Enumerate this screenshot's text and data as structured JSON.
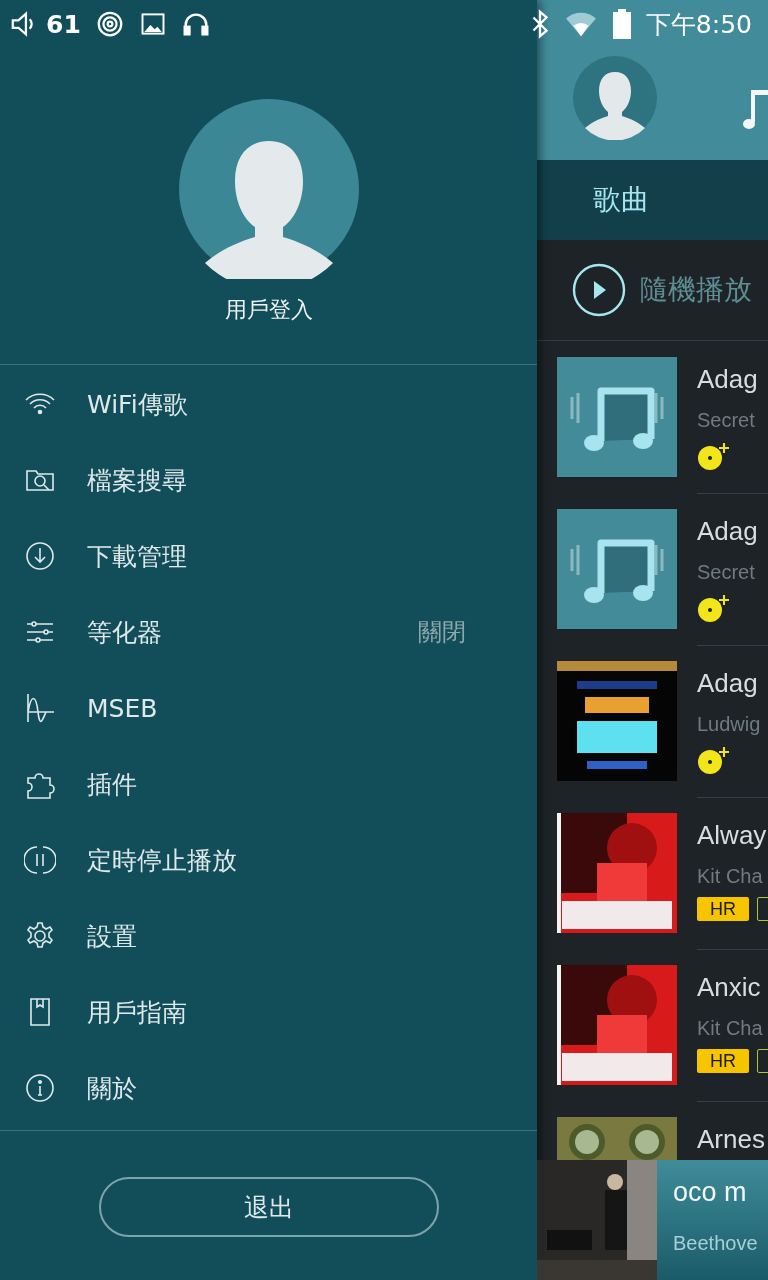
{
  "status_bar": {
    "volume": "61",
    "time": "下午8:50"
  },
  "drawer": {
    "login_label": "用戶登入",
    "menu": [
      {
        "label": "WiFi傳歌"
      },
      {
        "label": "檔案搜尋"
      },
      {
        "label": "下載管理"
      },
      {
        "label": "等化器",
        "value": "關閉"
      },
      {
        "label": "MSEB"
      },
      {
        "label": "插件"
      },
      {
        "label": "定時停止播放"
      },
      {
        "label": "設置"
      },
      {
        "label": "用戶指南"
      },
      {
        "label": "關於"
      }
    ],
    "logout_button": "退出"
  },
  "tabs": [
    {
      "label": "歌曲",
      "selected": true
    }
  ],
  "shuffle_label": "隨機播放",
  "songs": [
    {
      "title": "Adag",
      "artist": "Secret",
      "kind": "placeholder",
      "badges": [
        {
          "kind": "disc"
        }
      ]
    },
    {
      "title": "Adag",
      "artist": "Secret",
      "kind": "placeholder",
      "badges": [
        {
          "kind": "disc"
        }
      ]
    },
    {
      "title": "Adag",
      "artist": "Ludwig",
      "kind": "picture",
      "badges": [
        {
          "kind": "disc"
        }
      ]
    },
    {
      "title": "Alway",
      "artist": "Kit Cha",
      "kind": "picture",
      "badges": [
        {
          "kind": "tag",
          "text": "HR"
        },
        {
          "kind": "outline"
        }
      ]
    },
    {
      "title": "Anxic",
      "artist": "Kit Cha",
      "kind": "picture",
      "badges": [
        {
          "kind": "tag",
          "text": "HR"
        },
        {
          "kind": "outline"
        }
      ]
    },
    {
      "title": "Arnes",
      "kind": "picture"
    }
  ],
  "now_playing": {
    "title": "oco m",
    "artist": "Beethove"
  }
}
